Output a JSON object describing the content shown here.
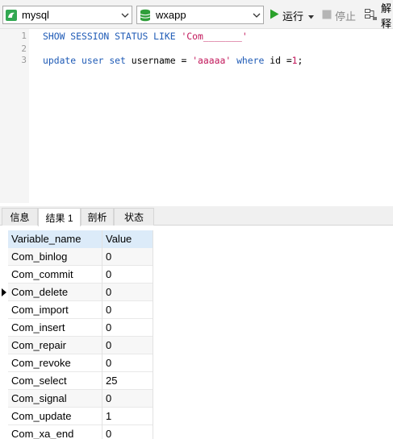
{
  "toolbar": {
    "connection": "mysql",
    "database": "wxapp",
    "run_label": "运行",
    "stop_label": "停止",
    "explain_label": "解释",
    "colors": {
      "run": "#2aa12a",
      "db_icon": "#2f9e3a",
      "conn_icon": "#32a852"
    }
  },
  "editor": {
    "line_numbers": [
      "1",
      "2",
      "3"
    ],
    "line1": {
      "kw1": "SHOW SESSION STATUS LIKE",
      "str": "'Com_______'"
    },
    "line3": {
      "kw_update": "update",
      "t_user": "user",
      "kw_set": "set",
      "t_username": "username",
      "eq": "=",
      "str": "'aaaaa'",
      "kw_where": "where",
      "t_id": "id",
      "eq2": "=",
      "num": "1",
      "semi": ";"
    }
  },
  "tabs": [
    {
      "label": "信息",
      "active": false
    },
    {
      "label": "结果 1",
      "active": true
    },
    {
      "label": "剖析",
      "active": false
    },
    {
      "label": "状态",
      "active": false
    }
  ],
  "grid": {
    "columns": [
      "Variable_name",
      "Value"
    ],
    "rows": [
      [
        "Com_binlog",
        "0"
      ],
      [
        "Com_commit",
        "0"
      ],
      [
        "Com_delete",
        "0"
      ],
      [
        "Com_import",
        "0"
      ],
      [
        "Com_insert",
        "0"
      ],
      [
        "Com_repair",
        "0"
      ],
      [
        "Com_revoke",
        "0"
      ],
      [
        "Com_select",
        "25"
      ],
      [
        "Com_signal",
        "0"
      ],
      [
        "Com_update",
        "1"
      ],
      [
        "Com_xa_end",
        "0"
      ]
    ],
    "selected_row": 2
  }
}
